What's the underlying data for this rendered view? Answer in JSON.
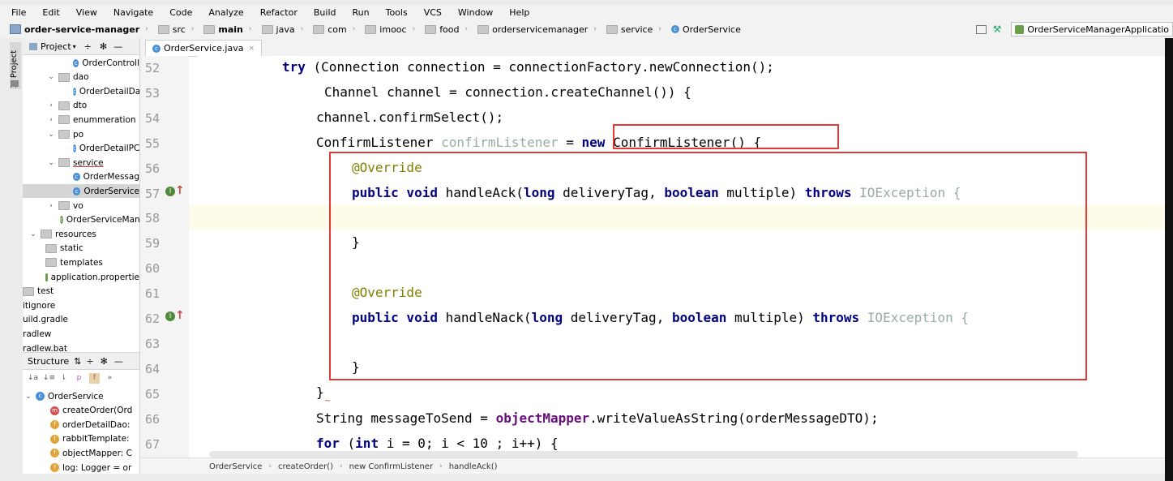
{
  "menu": [
    "File",
    "Edit",
    "View",
    "Navigate",
    "Code",
    "Analyze",
    "Refactor",
    "Build",
    "Run",
    "Tools",
    "VCS",
    "Window",
    "Help"
  ],
  "breadcrumbs": [
    {
      "label": "order-service-manager",
      "kind": "module",
      "bold": true
    },
    {
      "label": "src",
      "kind": "folder"
    },
    {
      "label": "main",
      "kind": "folder",
      "bold": true
    },
    {
      "label": "java",
      "kind": "folder"
    },
    {
      "label": "com",
      "kind": "folder"
    },
    {
      "label": "imooc",
      "kind": "folder"
    },
    {
      "label": "food",
      "kind": "folder"
    },
    {
      "label": "orderservicemanager",
      "kind": "folder"
    },
    {
      "label": "service",
      "kind": "folder"
    },
    {
      "label": "OrderService",
      "kind": "class"
    }
  ],
  "run_config": "OrderServiceManagerApplicatio",
  "sidebar_tab": "1: Project",
  "project_panel": {
    "title": "Project",
    "items": [
      {
        "label": "OrderControll",
        "indent": 62,
        "icon": "class",
        "twisty": ""
      },
      {
        "label": "dao",
        "indent": 30,
        "icon": "folder",
        "twisty": "v"
      },
      {
        "label": "OrderDetailDa",
        "indent": 62,
        "icon": "class",
        "twisty": ""
      },
      {
        "label": "dto",
        "indent": 30,
        "icon": "folder",
        "twisty": ">"
      },
      {
        "label": "enummeration",
        "indent": 30,
        "icon": "folder",
        "twisty": ">"
      },
      {
        "label": "po",
        "indent": 30,
        "icon": "folder",
        "twisty": "v"
      },
      {
        "label": "OrderDetailPC",
        "indent": 62,
        "icon": "class",
        "twisty": ""
      },
      {
        "label": "service",
        "indent": 30,
        "icon": "folder",
        "twisty": "v",
        "underline": true
      },
      {
        "label": "OrderMessag",
        "indent": 62,
        "icon": "class",
        "twisty": ""
      },
      {
        "label": "OrderService",
        "indent": 62,
        "icon": "class",
        "twisty": "",
        "selected": true
      },
      {
        "label": "vo",
        "indent": 30,
        "icon": "folder",
        "twisty": ">"
      },
      {
        "label": "OrderServiceMan",
        "indent": 46,
        "icon": "app",
        "twisty": ""
      },
      {
        "label": "resources",
        "indent": 8,
        "icon": "folder",
        "twisty": "v"
      },
      {
        "label": "static",
        "indent": 28,
        "icon": "folder",
        "twisty": ""
      },
      {
        "label": "templates",
        "indent": 28,
        "icon": "folder",
        "twisty": ""
      },
      {
        "label": "application.propertie",
        "indent": 28,
        "icon": "props",
        "twisty": ""
      },
      {
        "label": "test",
        "indent": 0,
        "icon": "folder",
        "twisty": ""
      },
      {
        "label": "itignore",
        "indent": 0,
        "icon": "",
        "twisty": ""
      },
      {
        "label": "uild.gradle",
        "indent": 0,
        "icon": "",
        "twisty": ""
      },
      {
        "label": "radlew",
        "indent": 0,
        "icon": "",
        "twisty": ""
      },
      {
        "label": "radlew.bat",
        "indent": 0,
        "icon": "",
        "twisty": ""
      }
    ]
  },
  "structure_panel": {
    "title": "Structure",
    "items": [
      {
        "label": "OrderService",
        "badge": "c",
        "indent": 2,
        "twisty": "v"
      },
      {
        "label": "createOrder(Ord",
        "badge": "m",
        "indent": 34,
        "twisty": ""
      },
      {
        "label": "orderDetailDao:",
        "badge": "f",
        "indent": 34,
        "twisty": ""
      },
      {
        "label": "rabbitTemplate:",
        "badge": "f",
        "indent": 34,
        "twisty": ""
      },
      {
        "label": "objectMapper: C",
        "badge": "f",
        "indent": 34,
        "twisty": ""
      },
      {
        "label": "log: Logger = or",
        "badge": "f",
        "indent": 34,
        "twisty": ""
      }
    ]
  },
  "editor": {
    "tab": "OrderService.java",
    "line_numbers": [
      "52",
      "53",
      "54",
      "55",
      "56",
      "57",
      "58",
      "59",
      "60",
      "61",
      "62",
      "63",
      "64",
      "65",
      "66",
      "67"
    ],
    "code": {
      "l52_try": "try",
      "l52_rest": " (Connection connection = connectionFactory.newConnection();",
      "l53": "Channel channel = connection.createChannel()) {",
      "l54": "channel.confirmSelect();",
      "l55_type": "ConfirmListener ",
      "l55_var": "confirmListener",
      "l55_eq": " = ",
      "l55_new": "new",
      "l55_rest": " ConfirmListener() {",
      "l56": "@Override",
      "l57_pv": "public void",
      "l57_name": " handleAck(",
      "l57_long": "long",
      "l57_dt": " deliveryTag, ",
      "l57_bool": "boolean",
      "l57_mult": " multiple) ",
      "l57_throws": "throws",
      "l57_exc": " IOException {",
      "l59": "}",
      "l61": "@Override",
      "l62_pv": "public void",
      "l62_name": " handleNack(",
      "l62_long": "long",
      "l62_dt": " deliveryTag, ",
      "l62_bool": "boolean",
      "l62_mult": " multiple) ",
      "l62_throws": "throws",
      "l62_exc": " IOException {",
      "l64": "}",
      "l65": "}",
      "l66_a": "String messageToSend = ",
      "l66_field": "objectMapper",
      "l66_b": ".writeValueAsString(orderMessageDTO);",
      "l67_for": "for",
      "l67_a": " (",
      "l67_int": "int",
      "l67_b": " i = 0; i < 10 ; i++) {"
    }
  },
  "bottom_breadcrumbs": [
    "OrderService",
    "createOrder()",
    "new ConfirmListener",
    "handleAck()"
  ],
  "colors": {
    "highlight_box": "#e53935",
    "keyword": "#000080",
    "annotation": "#808000"
  }
}
